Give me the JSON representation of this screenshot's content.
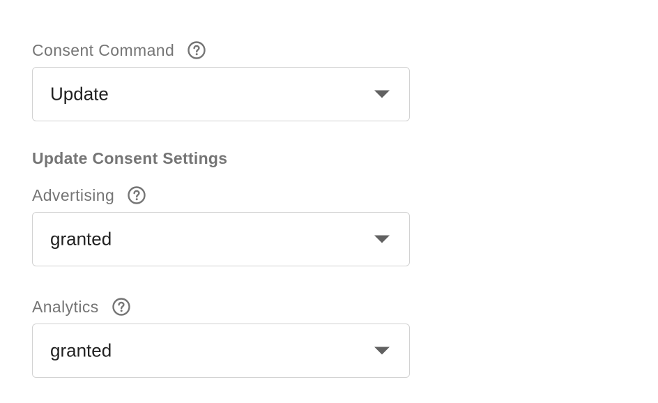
{
  "consent_command": {
    "label": "Consent Command",
    "help_icon": "help-circle-icon",
    "selected": "Update"
  },
  "update_section": {
    "heading": "Update Consent Settings"
  },
  "advertising": {
    "label": "Advertising",
    "help_icon": "help-circle-icon",
    "selected": "granted"
  },
  "analytics": {
    "label": "Analytics",
    "help_icon": "help-circle-icon",
    "selected": "granted"
  },
  "colors": {
    "label_text": "#757575",
    "value_text": "#212121",
    "border": "#d2d2d2",
    "caret": "#616161"
  }
}
